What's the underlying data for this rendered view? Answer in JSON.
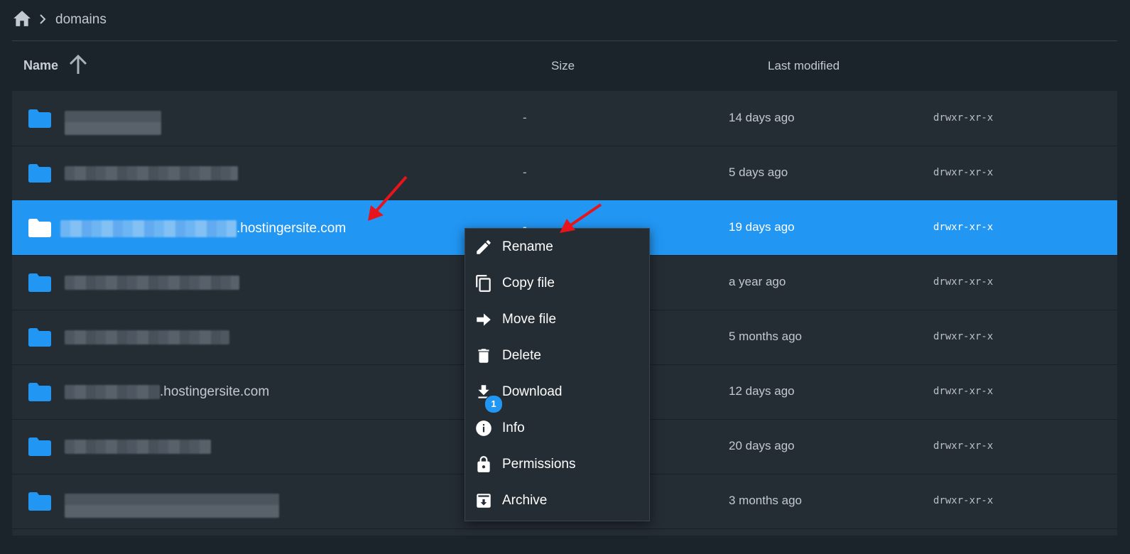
{
  "breadcrumb": {
    "current": "domains"
  },
  "columns": {
    "name": "Name",
    "size": "Size",
    "last_modified": "Last modified"
  },
  "rows": [
    {
      "name_suffix": "",
      "size": "-",
      "modified": "14 days ago",
      "perm": "drwxr-xr-x"
    },
    {
      "name_suffix": "",
      "size": "-",
      "modified": "5 days ago",
      "perm": "drwxr-xr-x"
    },
    {
      "name_suffix": ".hostingersite.com",
      "size": "-",
      "modified": "19 days ago",
      "perm": "drwxr-xr-x"
    },
    {
      "name_suffix": "",
      "size": "",
      "modified": "a year ago",
      "perm": "drwxr-xr-x"
    },
    {
      "name_suffix": "",
      "size": "",
      "modified": "5 months ago",
      "perm": "drwxr-xr-x"
    },
    {
      "name_suffix": ".hostingersite.com",
      "size": "",
      "modified": "12 days ago",
      "perm": "drwxr-xr-x"
    },
    {
      "name_suffix": "",
      "size": "",
      "modified": "20 days ago",
      "perm": "drwxr-xr-x"
    },
    {
      "name_suffix": "",
      "size": "",
      "modified": "3 months ago",
      "perm": "drwxr-xr-x"
    }
  ],
  "context_menu": {
    "items": [
      {
        "label": "Rename",
        "icon": "pencil-icon"
      },
      {
        "label": "Copy file",
        "icon": "copy-icon"
      },
      {
        "label": "Move file",
        "icon": "arrow-right-icon"
      },
      {
        "label": "Delete",
        "icon": "trash-icon"
      },
      {
        "label": "Download",
        "icon": "download-icon"
      },
      {
        "label": "Info",
        "icon": "info-icon"
      },
      {
        "label": "Permissions",
        "icon": "lock-icon"
      },
      {
        "label": "Archive",
        "icon": "archive-icon"
      }
    ],
    "download_badge": "1"
  },
  "colors": {
    "background": "#1b232b",
    "list_background": "#242c34",
    "selected_row": "#2196f3",
    "folder": "#2196f3",
    "annotation_arrow": "#e8141b"
  }
}
